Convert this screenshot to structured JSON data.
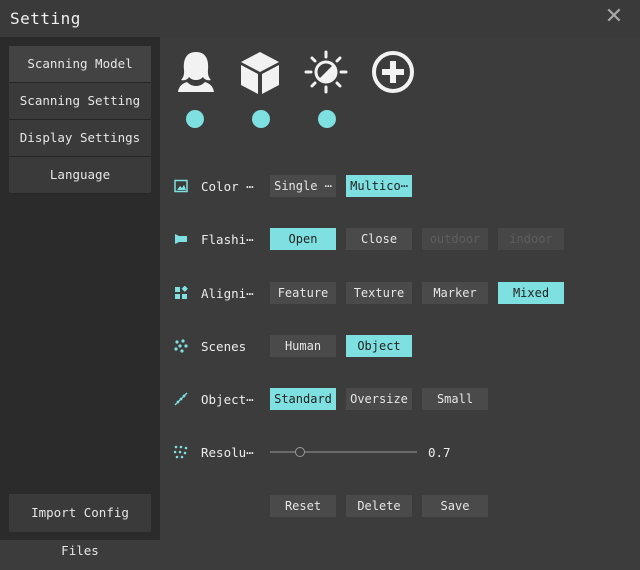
{
  "window": {
    "title": "Setting",
    "close_icon": "close-icon",
    "accent_color": "#7ee0e0"
  },
  "sidebar": {
    "items": [
      {
        "label": "Scanning Model",
        "active": true
      },
      {
        "label": "Scanning Setting",
        "active": false
      },
      {
        "label": "Display Settings",
        "active": false
      },
      {
        "label": "Language",
        "active": false
      }
    ],
    "import_label": "Import Config Files"
  },
  "modes": [
    {
      "icon": "human-head-icon",
      "has_dot": true
    },
    {
      "icon": "box-object-icon",
      "has_dot": true
    },
    {
      "icon": "sun-brightness-icon",
      "has_dot": true
    },
    {
      "icon": "add-circle-icon",
      "has_dot": false
    }
  ],
  "rows": {
    "color": {
      "label": "Color ⋯",
      "icon": "image-icon",
      "options": [
        {
          "label": "Single ⋯",
          "state": "normal"
        },
        {
          "label": "Multico⋯",
          "state": "selected"
        }
      ]
    },
    "flash": {
      "label": "Flashi⋯",
      "icon": "flashlight-icon",
      "options": [
        {
          "label": "Open",
          "state": "selected"
        },
        {
          "label": "Close",
          "state": "normal"
        },
        {
          "label": "outdoor",
          "state": "disabled"
        },
        {
          "label": "indoor",
          "state": "disabled"
        }
      ]
    },
    "align": {
      "label": "Aligni⋯",
      "icon": "grid-shapes-icon",
      "options": [
        {
          "label": "Feature",
          "state": "normal"
        },
        {
          "label": "Texture",
          "state": "normal"
        },
        {
          "label": "Marker",
          "state": "normal"
        },
        {
          "label": "Mixed",
          "state": "selected"
        }
      ]
    },
    "scenes": {
      "label": "Scenes",
      "icon": "dots-cluster-icon",
      "options": [
        {
          "label": "Human",
          "state": "normal"
        },
        {
          "label": "Object",
          "state": "selected"
        }
      ]
    },
    "object": {
      "label": "Object⋯",
      "icon": "ruler-icon",
      "options": [
        {
          "label": "Standard",
          "state": "selected"
        },
        {
          "label": "Oversize",
          "state": "normal"
        },
        {
          "label": "Small",
          "state": "normal"
        }
      ]
    },
    "resolution": {
      "label": "Resolu⋯",
      "icon": "dots-grid-icon",
      "value": "0.7"
    }
  },
  "footer": {
    "reset_label": "Reset",
    "delete_label": "Delete",
    "save_label": "Save"
  }
}
